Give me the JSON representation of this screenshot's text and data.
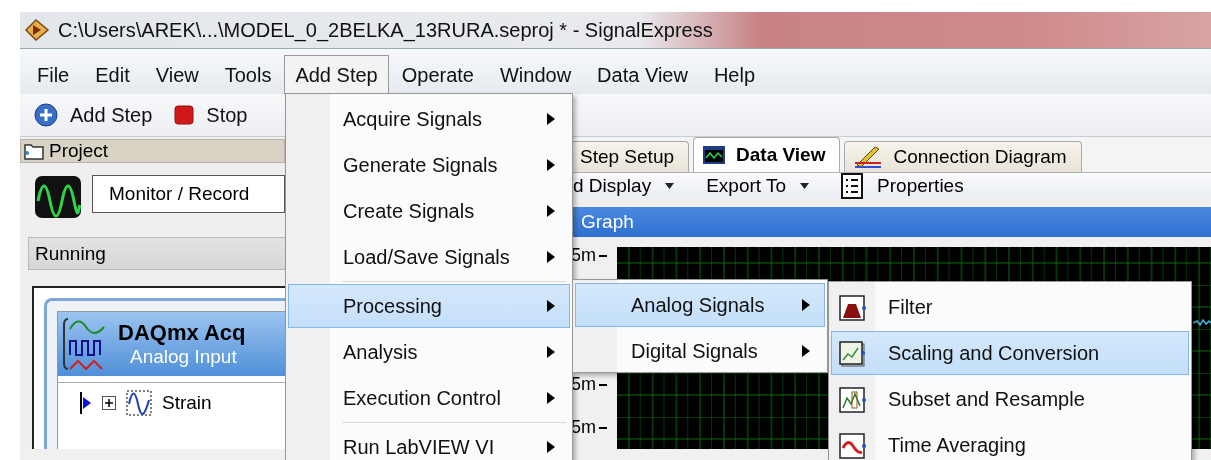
{
  "window": {
    "title": "C:\\Users\\AREK\\...\\MODEL_0_2BELKA_13RURA.seproj * - SignalExpress"
  },
  "menubar": {
    "items": [
      {
        "label": "File",
        "selected": false
      },
      {
        "label": "Edit",
        "selected": false
      },
      {
        "label": "View",
        "selected": false
      },
      {
        "label": "Tools",
        "selected": false
      },
      {
        "label": "Add Step",
        "selected": true
      },
      {
        "label": "Operate",
        "selected": false
      },
      {
        "label": "Window",
        "selected": false
      },
      {
        "label": "Data View",
        "selected": false
      },
      {
        "label": "Help",
        "selected": false
      }
    ]
  },
  "toolbar": {
    "buttons": [
      {
        "kind": "add",
        "label": "Add Step"
      },
      {
        "kind": "stop",
        "label": "Stop"
      }
    ]
  },
  "project_panel": {
    "header": "Project",
    "mode": "Monitor / Record",
    "status": "Running",
    "step": {
      "title": "DAQmx Acq",
      "subtitle": "Analog Input",
      "channel": "Strain"
    }
  },
  "tabs": [
    {
      "label": "Step Setup",
      "selected": false
    },
    {
      "label": "Data View",
      "selected": true
    },
    {
      "label": "Connection Diagram",
      "selected": false
    }
  ],
  "view_toolbar": {
    "items": [
      {
        "kind": "dropdown",
        "label": "d Display"
      },
      {
        "kind": "dropdown",
        "label": "Export To"
      },
      {
        "kind": "properties",
        "label": "Properties"
      }
    ]
  },
  "graph": {
    "title": "Graph",
    "y_axis_labels": [
      "5m",
      "5m",
      "5m"
    ]
  },
  "add_step_menu": {
    "items": [
      {
        "kind": "item",
        "label": "Acquire Signals",
        "submenu": true,
        "selected": false
      },
      {
        "kind": "item",
        "label": "Generate Signals",
        "submenu": true,
        "selected": false
      },
      {
        "kind": "item",
        "label": "Create Signals",
        "submenu": true,
        "selected": false
      },
      {
        "kind": "item",
        "label": "Load/Save Signals",
        "submenu": true,
        "selected": false
      },
      {
        "kind": "separator"
      },
      {
        "kind": "item",
        "label": "Processing",
        "submenu": true,
        "selected": true
      },
      {
        "kind": "item",
        "label": "Analysis",
        "submenu": true,
        "selected": false
      },
      {
        "kind": "item",
        "label": "Execution Control",
        "submenu": true,
        "selected": false
      },
      {
        "kind": "separator"
      },
      {
        "kind": "item",
        "label": "Run LabVIEW VI",
        "submenu": true,
        "selected": false
      }
    ]
  },
  "processing_menu": {
    "items": [
      {
        "kind": "item",
        "label": "Analog Signals",
        "submenu": true,
        "selected": true
      },
      {
        "kind": "item",
        "label": "Digital Signals",
        "submenu": true,
        "selected": false
      }
    ]
  },
  "analog_menu": {
    "items": [
      {
        "kind": "item",
        "label": "Filter",
        "submenu": false,
        "selected": false
      },
      {
        "kind": "item",
        "label": "Scaling and Conversion",
        "submenu": false,
        "selected": true
      },
      {
        "kind": "item",
        "label": "Subset and Resample",
        "submenu": false,
        "selected": false
      },
      {
        "kind": "item",
        "label": "Time Averaging",
        "submenu": false,
        "selected": false
      }
    ]
  }
}
